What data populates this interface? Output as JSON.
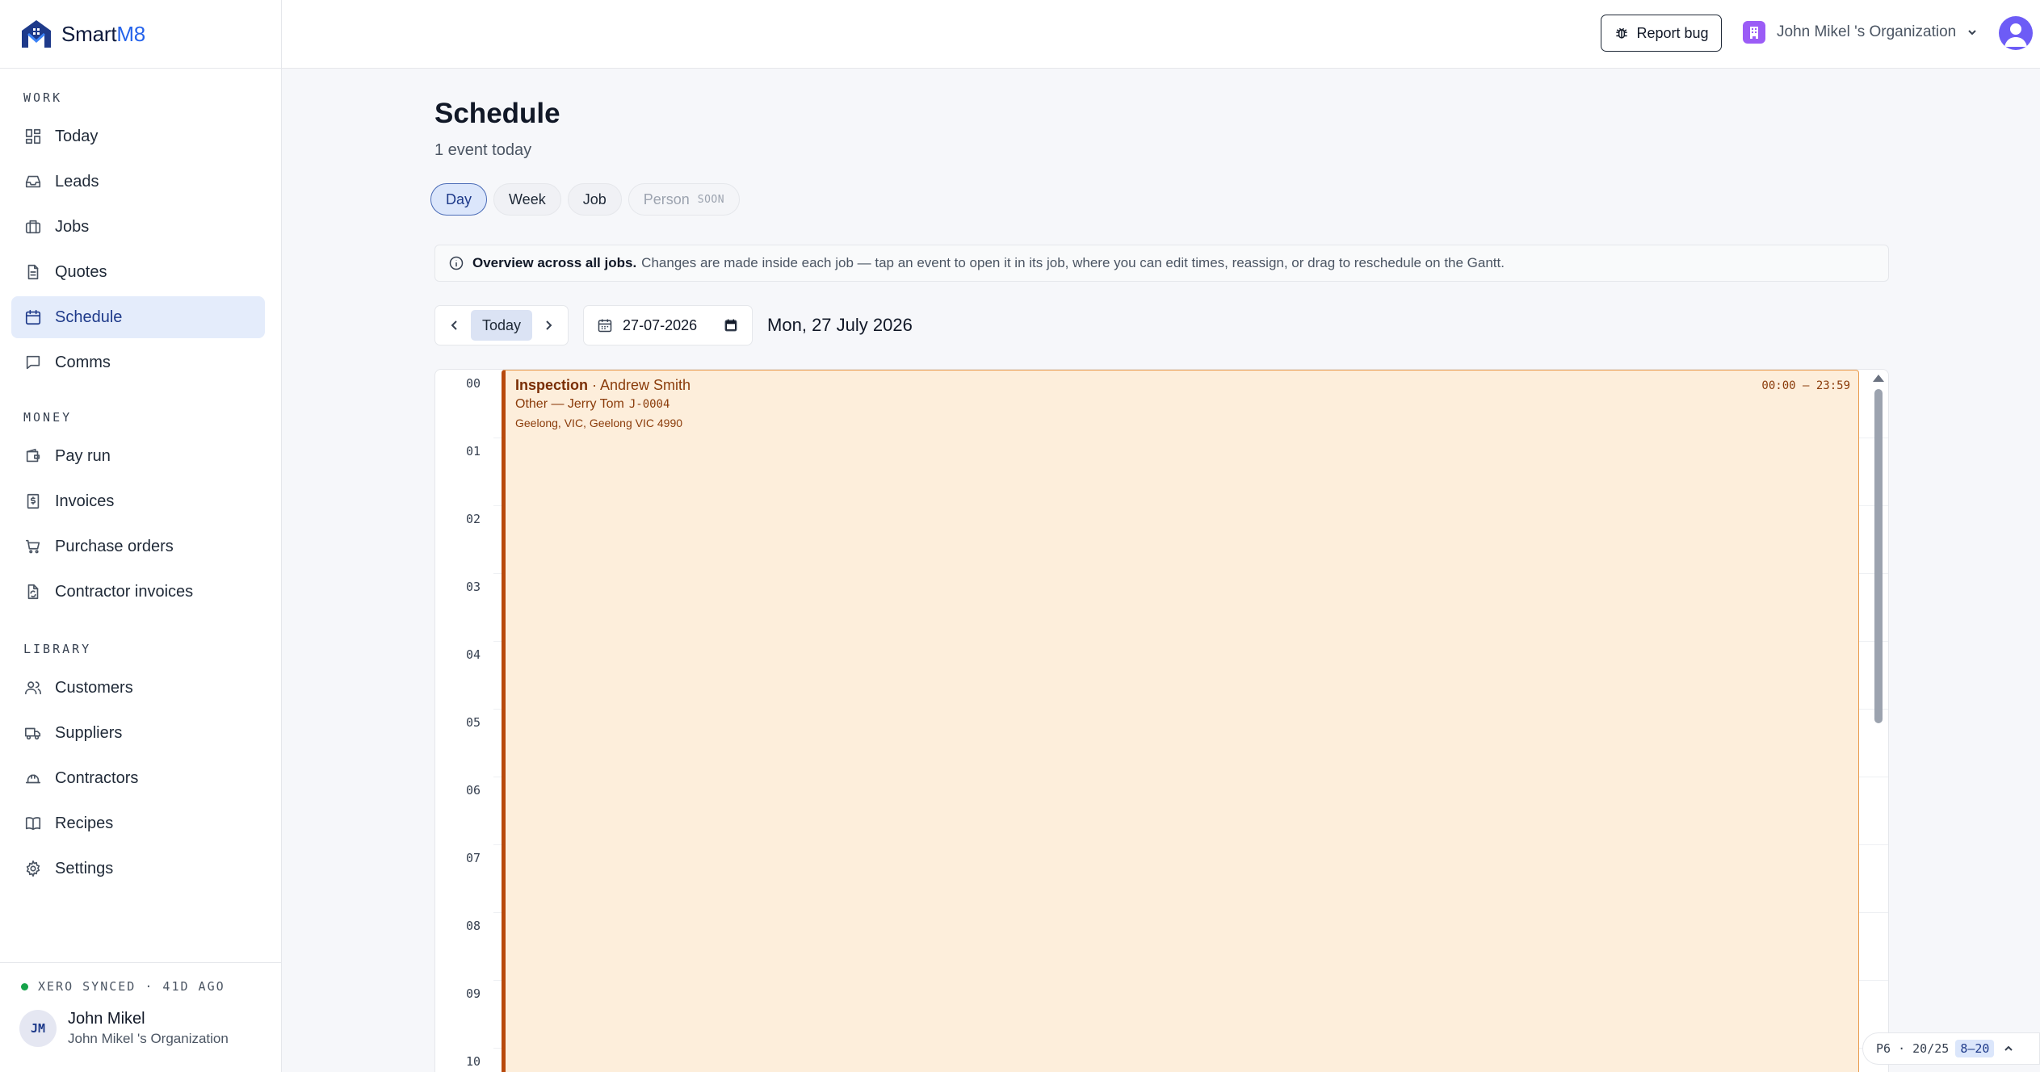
{
  "brand": {
    "name_prefix": "Smart",
    "name_suffix": "M8"
  },
  "sidebar": {
    "sections": [
      {
        "title": "WORK",
        "items": [
          {
            "label": "Today",
            "icon": "grid-icon"
          },
          {
            "label": "Leads",
            "icon": "inbox-icon"
          },
          {
            "label": "Jobs",
            "icon": "briefcase-icon"
          },
          {
            "label": "Quotes",
            "icon": "document-icon"
          },
          {
            "label": "Schedule",
            "icon": "calendar-icon",
            "active": true
          },
          {
            "label": "Comms",
            "icon": "chat-icon"
          }
        ]
      },
      {
        "title": "MONEY",
        "items": [
          {
            "label": "Pay run",
            "icon": "wallet-icon"
          },
          {
            "label": "Invoices",
            "icon": "invoice-icon"
          },
          {
            "label": "Purchase orders",
            "icon": "cart-icon"
          },
          {
            "label": "Contractor invoices",
            "icon": "file-refresh-icon"
          }
        ]
      },
      {
        "title": "LIBRARY",
        "items": [
          {
            "label": "Customers",
            "icon": "users-icon"
          },
          {
            "label": "Suppliers",
            "icon": "truck-icon"
          },
          {
            "label": "Contractors",
            "icon": "hardhat-icon"
          },
          {
            "label": "Recipes",
            "icon": "book-icon"
          },
          {
            "label": "Settings",
            "icon": "gear-icon"
          }
        ]
      }
    ],
    "sync_status": "XERO SYNCED · 41D AGO",
    "user": {
      "initials": "JM",
      "name": "John Mikel",
      "org": "John Mikel 's Organization"
    }
  },
  "topbar": {
    "report_bug": "Report bug",
    "org_name": "John Mikel 's Organization"
  },
  "main": {
    "title": "Schedule",
    "subtitle": "1 event today",
    "tabs": [
      {
        "label": "Day",
        "active": true
      },
      {
        "label": "Week"
      },
      {
        "label": "Job"
      },
      {
        "label": "Person",
        "badge": "SOON",
        "disabled": true
      }
    ],
    "info": {
      "bold": "Overview across all jobs.",
      "text": "Changes are made inside each job — tap an event to open it in its job, where you can edit times, reassign, or drag to reschedule on the Gantt."
    },
    "toolbar": {
      "today": "Today",
      "date_value": "27-07-2026",
      "date_label": "Mon, 27 July 2026"
    },
    "hours": [
      "00",
      "01",
      "02",
      "03",
      "04",
      "05",
      "06",
      "07",
      "08",
      "09",
      "10"
    ],
    "event": {
      "type": "Inspection",
      "person": " · Andrew Smith",
      "detail": "Other — Jerry Tom",
      "code": "J-0004",
      "address": "Geelong, VIC, Geelong VIC 4990",
      "time": "00:00 – 23:59"
    },
    "pager": {
      "text": "P6 · 20/25",
      "range": "8–20"
    }
  },
  "colors": {
    "accent": "#2563eb",
    "active_nav_bg": "#e4ecfb",
    "event_bg": "#fdeedb",
    "event_border": "#b8480b",
    "sync_dot": "#16a34a",
    "org_icon": "#9b5cf6"
  }
}
